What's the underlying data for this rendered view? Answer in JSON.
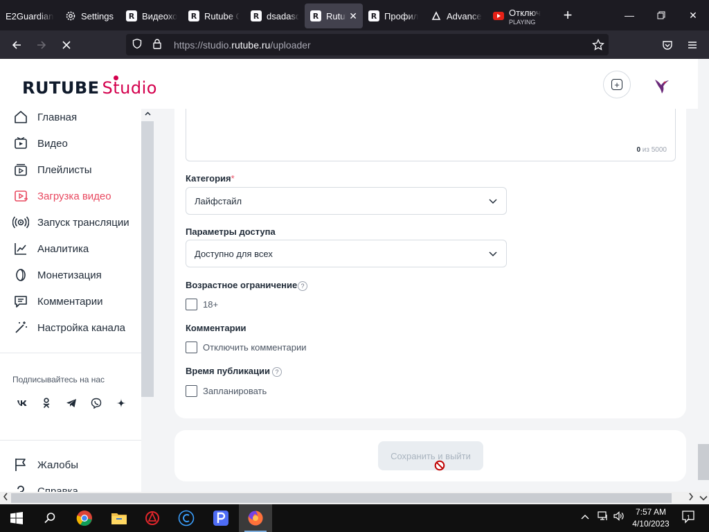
{
  "browser": {
    "tabs": [
      {
        "title": "E2Guardian -",
        "favicon": "none"
      },
      {
        "title": "Settings",
        "favicon": "gear-icon"
      },
      {
        "title": "Видеохо",
        "favicon": "rutube-icon"
      },
      {
        "title": "Rutube C",
        "favicon": "rutube-icon"
      },
      {
        "title": "dsadasda",
        "favicon": "rutube-icon"
      },
      {
        "title": "Rutub",
        "favicon": "rutube-icon",
        "active": true
      },
      {
        "title": "Профил",
        "favicon": "rutube-icon"
      },
      {
        "title": "Advance",
        "favicon": "advance-icon"
      },
      {
        "title": "Отключ",
        "subtitle": "PLAYING",
        "favicon": "youtube-icon"
      }
    ],
    "new_tab": "+",
    "url_prefix": "https://studio.",
    "url_domain": "rutube.ru",
    "url_path": "/uploader"
  },
  "header": {
    "logo_main": "RUTUBE",
    "logo_studio": "Studio",
    "brand_color": "#d4004d"
  },
  "sidebar": {
    "items": [
      {
        "label": "Главная",
        "icon": "home-icon"
      },
      {
        "label": "Видео",
        "icon": "video-icon"
      },
      {
        "label": "Плейлисты",
        "icon": "playlist-icon"
      },
      {
        "label": "Загрузка видео",
        "icon": "upload-video-icon",
        "active": true
      },
      {
        "label": "Запуск трансляции",
        "icon": "broadcast-icon"
      },
      {
        "label": "Аналитика",
        "icon": "analytics-icon"
      },
      {
        "label": "Монетизация",
        "icon": "monetization-icon"
      },
      {
        "label": "Комментарии",
        "icon": "comments-icon"
      },
      {
        "label": "Настройка канала",
        "icon": "magic-wand-icon"
      }
    ],
    "follow_label": "Подписывайтесь на нас",
    "social": [
      "ВК",
      "ОК",
      "Telegram",
      "Viber",
      "Дзен"
    ],
    "bottom_items": [
      {
        "label": "Жалобы",
        "icon": "flag-icon"
      },
      {
        "label": "Справка",
        "icon": "help-icon"
      }
    ]
  },
  "form": {
    "description_count": "0",
    "description_max": "из 5000",
    "category_label": "Категория",
    "category_required": "*",
    "category_value": "Лайфстайл",
    "access_label": "Параметры доступа",
    "access_value": "Доступно для всех",
    "age_label": "Возрастное ограничение",
    "age_option": "18+",
    "age_checked": false,
    "comments_label": "Комментарии",
    "comments_option": "Отключить комментарии",
    "comments_checked": false,
    "publish_label": "Время публикации",
    "publish_option": "Запланировать",
    "publish_checked": false,
    "save_button": "Сохранить и выйти"
  },
  "taskbar": {
    "time": "7:57 AM",
    "date": "4/10/2023",
    "notifications": "1"
  }
}
